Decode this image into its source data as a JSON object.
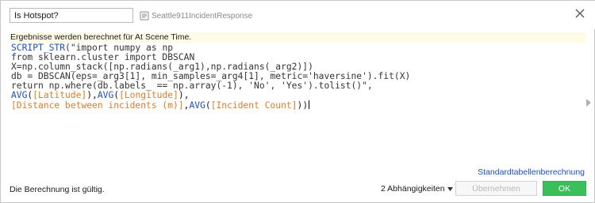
{
  "header": {
    "calc_name": "Is Hotspot?",
    "datasource": "Seattle911IncidentResponse"
  },
  "info_message": "Ergebnisse werden berechnet für At Scene Time.",
  "editor": {
    "lines": [
      [
        {
          "t": "SCRIPT_STR",
          "c": "fn"
        },
        {
          "t": "(\"import numpy as np",
          "c": "str"
        }
      ],
      [
        {
          "t": "from sklearn.cluster import DBSCAN",
          "c": "str"
        }
      ],
      [
        {
          "t": "X=np.column_stack([np.radians(_arg1),np.radians(_arg2)])",
          "c": "str"
        }
      ],
      [
        {
          "t": "db = DBSCAN(eps=_arg3[1], min_samples=_arg4[1], metric='haversine').fit(X)",
          "c": "str"
        }
      ],
      [
        {
          "t": "return np.where(db.labels_ == np.array(-1), 'No', 'Yes').tolist()\",",
          "c": "str"
        }
      ],
      [
        {
          "t": "AVG",
          "c": "fn"
        },
        {
          "t": "(",
          "c": "op"
        },
        {
          "t": "[Latitude]",
          "c": "fld"
        },
        {
          "t": "),",
          "c": "op"
        },
        {
          "t": "AVG",
          "c": "fn"
        },
        {
          "t": "(",
          "c": "op"
        },
        {
          "t": "[Longitude]",
          "c": "fld"
        },
        {
          "t": "),",
          "c": "op"
        }
      ],
      [
        {
          "t": "[Distance between incidents (m)]",
          "c": "fld"
        },
        {
          "t": ",",
          "c": "op"
        },
        {
          "t": "AVG",
          "c": "fn"
        },
        {
          "t": "(",
          "c": "op"
        },
        {
          "t": "[Incident Count]",
          "c": "fld"
        },
        {
          "t": "))",
          "c": "op"
        }
      ]
    ]
  },
  "footer": {
    "default_table_link": "Standardtabellenberechnung",
    "status": "Die Berechnung ist gültig.",
    "dependencies": "2 Abhängigkeiten",
    "apply_label": "Übernehmen",
    "ok_label": "OK"
  },
  "colors": {
    "function": "#1f4fb8",
    "field": "#e07b28",
    "ok_button": "#3bbf5a",
    "link": "#1a4fc4"
  },
  "icons": {
    "datasource": "database-icon",
    "close": "close-icon",
    "dependencies_caret": "caret-down-icon",
    "scroll": "scroll-right-arrow-icon"
  }
}
